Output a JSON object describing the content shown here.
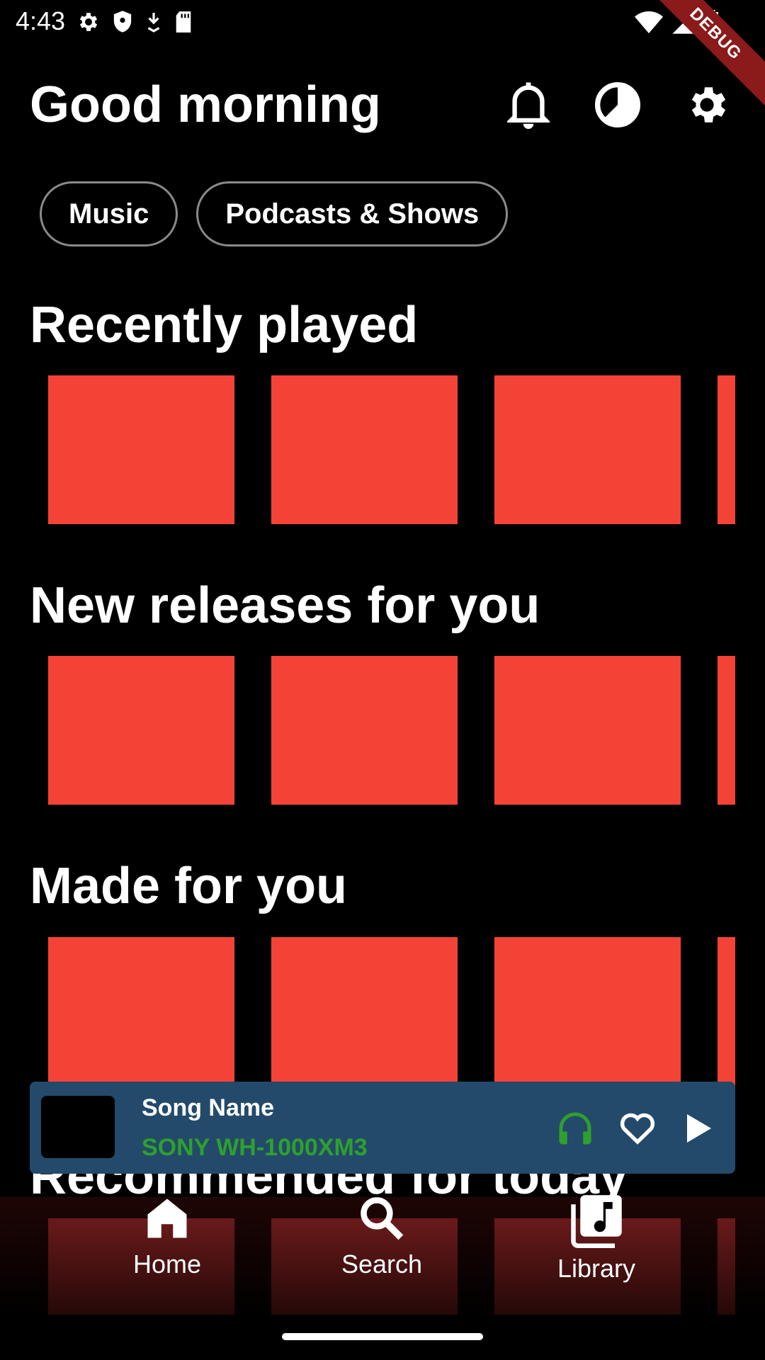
{
  "status_bar": {
    "time": "4:43",
    "left_icons": [
      "gear-icon",
      "shield-icon",
      "download-icon",
      "sd-card-icon"
    ],
    "right_icons": [
      "wifi-icon",
      "signal-icon",
      "battery-icon"
    ],
    "debug_label": "DEBUG"
  },
  "header": {
    "greeting": "Good morning",
    "icons": [
      "bell-icon",
      "history-icon",
      "settings-icon"
    ]
  },
  "chips": [
    {
      "label": "Music"
    },
    {
      "label": "Podcasts & Shows"
    }
  ],
  "sections": [
    {
      "title": "Recently played",
      "tiles": 4
    },
    {
      "title": "New releases for you",
      "tiles": 4
    },
    {
      "title": "Made for you",
      "tiles": 4
    },
    {
      "title": "Recommended for today",
      "tiles": 4
    }
  ],
  "colors": {
    "tile": "#f44336",
    "player_bg": "#234a6a",
    "device_green": "#2ea02e"
  },
  "mini_player": {
    "song_name": "Song Name",
    "device": "SONY WH-1000XM3",
    "icons": [
      "headphones-icon",
      "heart-icon",
      "play-icon"
    ]
  },
  "bottom_nav": [
    {
      "label": "Home",
      "icon": "home-icon"
    },
    {
      "label": "Search",
      "icon": "search-icon"
    },
    {
      "label": "Library",
      "icon": "library-icon"
    }
  ]
}
